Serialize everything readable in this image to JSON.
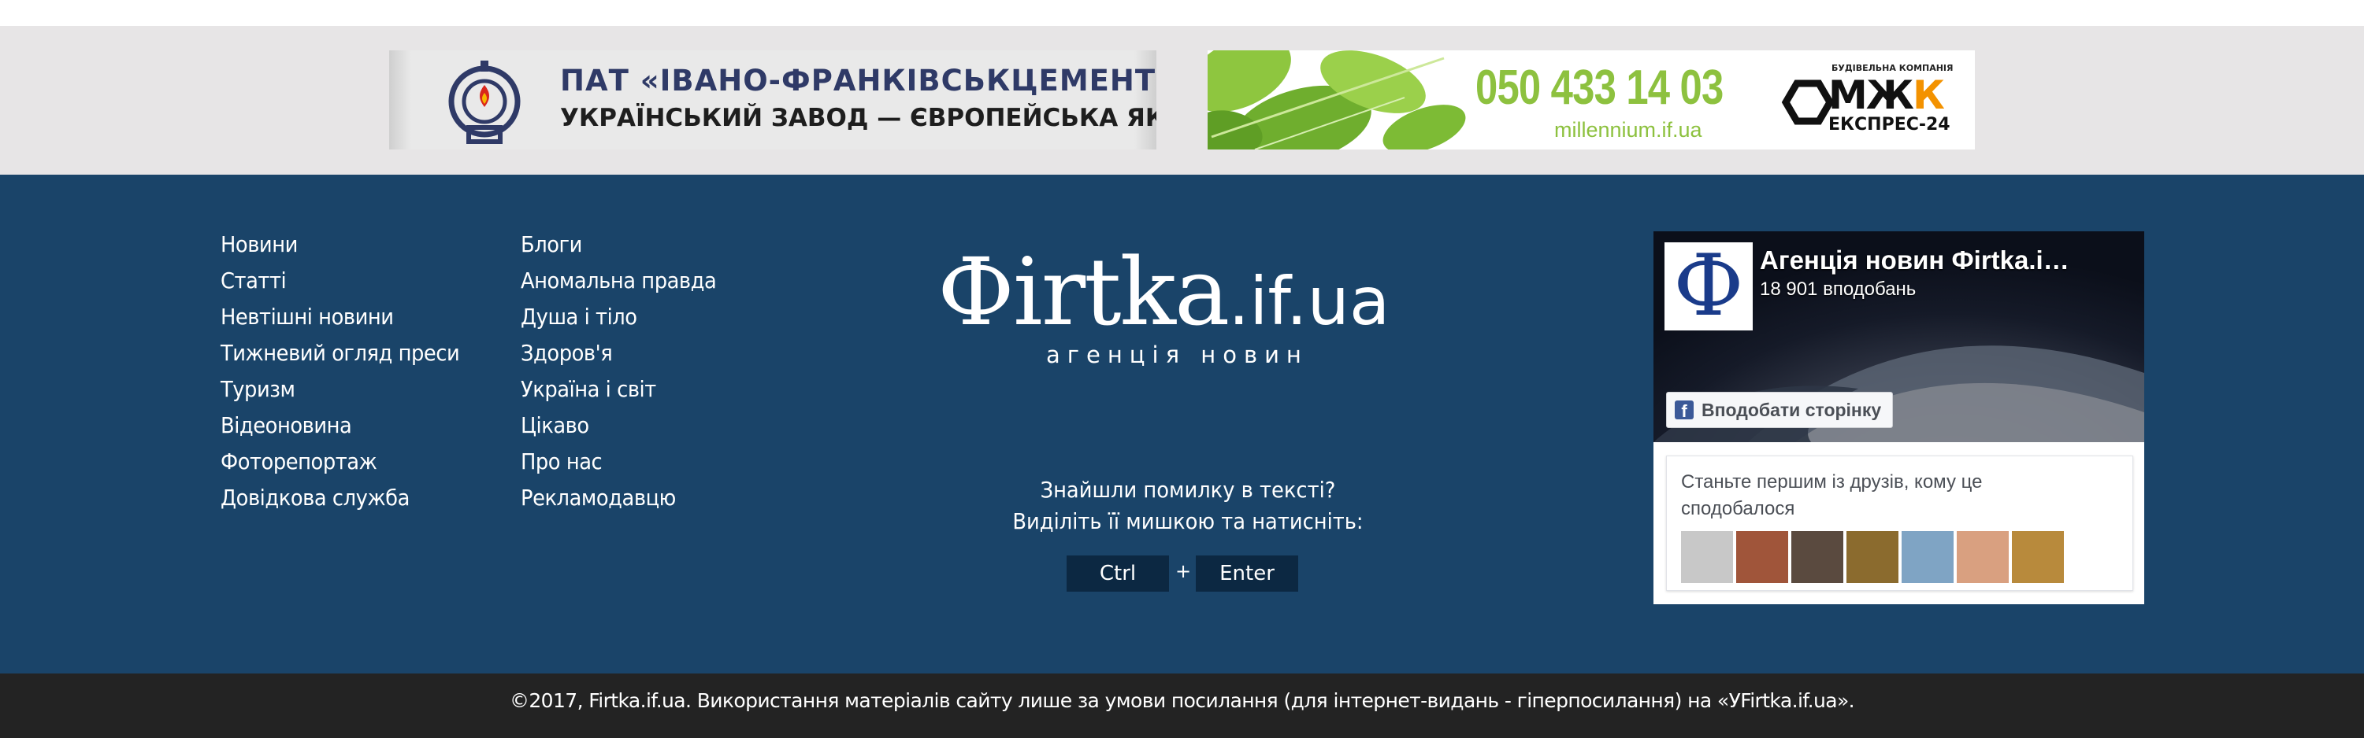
{
  "banners": {
    "cement": {
      "line1": "ПАТ «ІВАНО-ФРАНКІВСЬКЦЕМЕНТ»",
      "line2": "УКРАЇНСЬКИЙ ЗАВОД — ЄВРОПЕЙСЬКА ЯКІСТЬ!"
    },
    "mjk": {
      "phone": "050 433 14 03",
      "site": "millennium.if.ua",
      "small": "БУДІВЕЛЬНА КОМПАНІЯ",
      "brand_a": "МЖ",
      "brand_b": "К",
      "sub": "ЕКСПРЕС-24"
    }
  },
  "menu": {
    "col1": [
      "Новини",
      "Статті",
      "Невтішні новини",
      "Тижневий огляд преси",
      "Туризм",
      "Відеоновина",
      "Фоторепортаж",
      "Довідкова служба"
    ],
    "col2": [
      "Блоги",
      "Аномальна правда",
      "Душа і тіло",
      "Здоров'я",
      "Україна і світ",
      "Цікаво",
      "Про нас",
      "Рекламодавцю"
    ]
  },
  "logo": {
    "name": "Фirtka",
    "domain": ".if.ua",
    "tagline": "агенція новин"
  },
  "error_report": {
    "line1": "Знайшли помилку в тексті?",
    "line2": "Виділіть її мишкою та натисніть:",
    "key1": "Ctrl",
    "plus": "+",
    "key2": "Enter"
  },
  "facebook": {
    "page_name": "Агенція новин Фirtka.i…",
    "likes": "18 901 вподобань",
    "like_button": "Вподобати сторінку",
    "friends_text": "Станьте першим із друзів, кому це сподобалося"
  },
  "copyright": "©2017, Firtka.if.ua. Використання матеріалів сайту лише за умови посилання (для інтернет-видань - гіперпосилання) на «УFirtka.if.ua».",
  "colors": {
    "footer_bg": "#1a4469",
    "banner_strip": "#e7e5e6",
    "copyright_bg": "#232323",
    "mjk_green": "#8dc13f",
    "mjk_orange": "#f39200"
  }
}
